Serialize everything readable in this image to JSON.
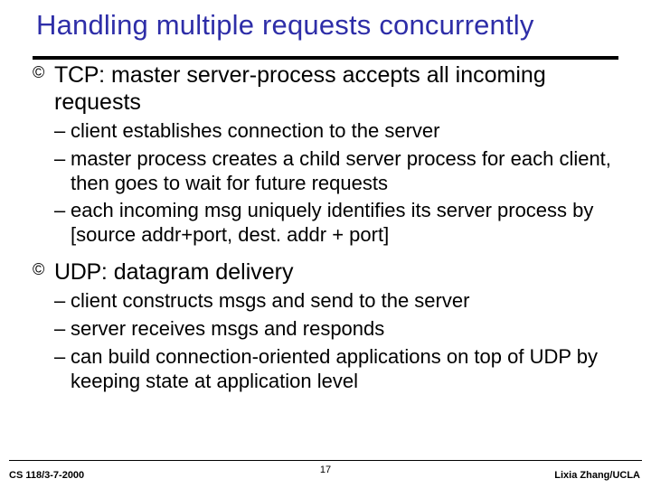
{
  "title": "Handling multiple requests concurrently",
  "items": [
    {
      "bullet": "©",
      "lead": "TCP",
      "rest": ": master server-process accepts all incoming requests",
      "subs": [
        "client establishes connection to the server",
        "master process creates a child server process for each client, then goes to wait for future requests",
        "each incoming msg uniquely identifies its server process by [source addr+port, dest. addr + port]"
      ]
    },
    {
      "bullet": "©",
      "lead": "UDP",
      "rest": ": datagram delivery",
      "subs": [
        "client constructs msgs and send to the server",
        "server receives msgs and responds",
        "can build connection-oriented applications on top of UDP by keeping state at application level"
      ]
    }
  ],
  "footer": {
    "left": "CS 118/3-7-2000",
    "center": "17",
    "right": "Lixia Zhang/UCLA"
  }
}
